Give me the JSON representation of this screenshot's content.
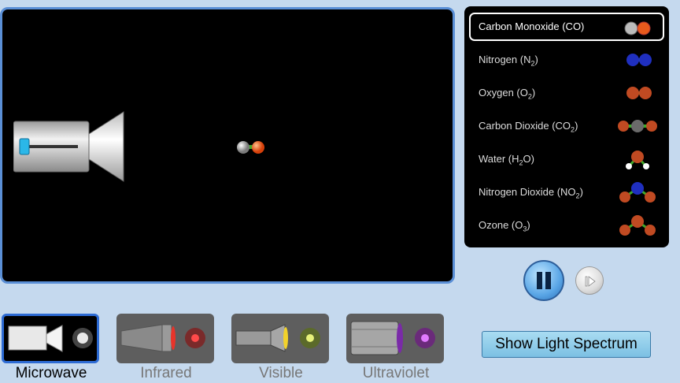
{
  "molecules": [
    {
      "name": "Carbon Monoxide (CO)",
      "selected": true
    },
    {
      "name": "Nitrogen (N2)",
      "selected": false
    },
    {
      "name": "Oxygen (O2)",
      "selected": false
    },
    {
      "name": "Carbon Dioxide (CO2)",
      "selected": false
    },
    {
      "name": "Water (H2O)",
      "selected": false
    },
    {
      "name": "Nitrogen Dioxide (NO2)",
      "selected": false
    },
    {
      "name": "Ozone (O3)",
      "selected": false
    }
  ],
  "sources": [
    {
      "label": "Microwave",
      "selected": true
    },
    {
      "label": "Infrared",
      "selected": false
    },
    {
      "label": "Visible",
      "selected": false
    },
    {
      "label": "Ultraviolet",
      "selected": false
    }
  ],
  "controls": {
    "spectrum_label": "Show Light Spectrum",
    "pause_icon": "pause-icon",
    "step_icon": "step-forward-icon"
  },
  "colors": {
    "carbon": "#9a9a9a",
    "oxygen": "#e85a1c",
    "nitrogen": "#1f2fbf",
    "hydrogen": "#ffffff",
    "selection_border": "#2d6bd4",
    "bond": "#3fa82a"
  }
}
